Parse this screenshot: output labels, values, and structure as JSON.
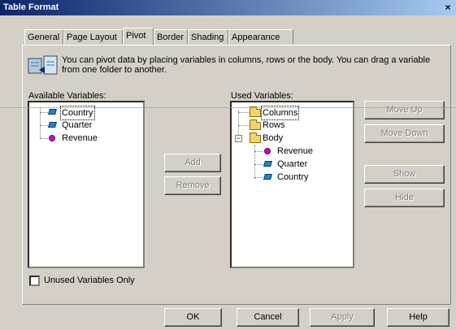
{
  "window": {
    "title": "Table Format",
    "close_glyph": "×"
  },
  "tabs": [
    {
      "label": "General",
      "active": false
    },
    {
      "label": "Page Layout",
      "active": false
    },
    {
      "label": "Pivot",
      "active": true
    },
    {
      "label": "Border",
      "active": false
    },
    {
      "label": "Shading",
      "active": false
    },
    {
      "label": "Appearance",
      "active": false
    }
  ],
  "info": {
    "text": "You can pivot data by placing variables in columns, rows or the body. You can drag a variable from one folder to another."
  },
  "available": {
    "label": "Available Variables:",
    "items": [
      "Country",
      "Quarter",
      "Revenue"
    ]
  },
  "used": {
    "label": "Used Variables:",
    "columns": "Columns",
    "rows": "Rows",
    "body": "Body",
    "body_items": [
      "Revenue",
      "Quarter",
      "Country"
    ]
  },
  "middle_buttons": {
    "add": "Add",
    "remove": "Remove"
  },
  "side_buttons": {
    "move_up": "Move Up",
    "move_down": "Move Down",
    "show": "Show",
    "hide": "Hide"
  },
  "unused_only": {
    "label": "Unused Variables Only",
    "checked": false
  },
  "footer": {
    "ok": "OK",
    "cancel": "Cancel",
    "apply": "Apply",
    "help": "Help"
  },
  "colors": {
    "title_start": "#0a246a",
    "title_end": "#a6caf0",
    "dialog": "#d4d0c8"
  }
}
